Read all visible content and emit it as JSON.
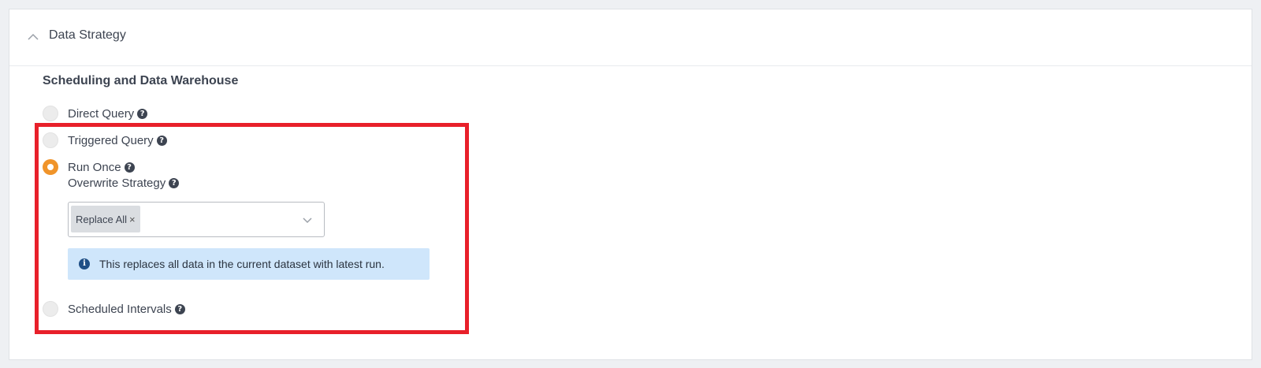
{
  "panel": {
    "title": "Data Strategy",
    "section_title": "Scheduling and Data Warehouse"
  },
  "options": [
    {
      "label": "Direct Query",
      "checked": false
    },
    {
      "label": "Triggered Query",
      "checked": false
    },
    {
      "label": "Run Once",
      "checked": true
    },
    {
      "label": "Scheduled Intervals",
      "checked": false
    }
  ],
  "overwrite": {
    "label": "Overwrite Strategy",
    "selected_chip": "Replace All",
    "chip_remove": "×"
  },
  "info": {
    "icon": "i",
    "text": "This replaces all data in the current dataset with latest run."
  },
  "help_glyph": "?",
  "colors": {
    "accent": "#f0942a",
    "highlight": "#e8202a",
    "info_bg": "#cfe6fb"
  },
  "icons": {
    "collapse": "chevron-up-icon",
    "dropdown": "chevron-down-icon",
    "help": "question-circle-icon",
    "info": "info-circle-icon",
    "remove": "close-icon"
  }
}
